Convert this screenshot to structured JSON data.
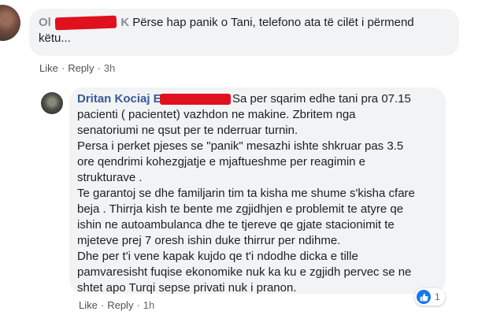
{
  "comment": {
    "author_prefix": "Ol",
    "author_suffix": "K",
    "text_line1": "Përse hap panik o Tani, telefono ata të cilët i përmend",
    "text_line2": "këtu...",
    "like_label": "Like",
    "reply_label": "Reply",
    "time": "3h"
  },
  "reply": {
    "author": "Dritan Kociaj E",
    "lines": [
      "Sa per sqarim edhe tani pra 07.15",
      "pacienti ( pacientet) vazhdon ne makine. Zbritem nga",
      "senatoriumi ne qsut per te nderruar turnin.",
      "Persa i perket pjeses se \"panik\" mesazhi ishte shkruar pas 3.5",
      "ore qendrimi kohezgjatje e mjaftueshme per reagimin e",
      "strukturave .",
      "Te garantoj se dhe familjarin tim ta kisha me shume s'kisha cfare",
      "beja . Thirrja kish te bente me zgjidhjen e problemit te atyre qe",
      "ishin ne autoambulanca dhe te tjereve qe gjate stacionimit te",
      "mjeteve prej 7 oresh ishin duke thirrur per ndihme.",
      "Dhe per t'i vene kapak kujdo qe t'i ndodhe dicka e tille",
      "pamvaresisht fuqise ekonomike nuk ka ku e zgjidh pervec se ne",
      "shtet apo Turqi sepse privati nuk i pranon."
    ],
    "like_label": "Like",
    "reply_label": "Reply",
    "time": "1h",
    "reaction_count": "1",
    "reaction_icon": "thumbs-up-icon"
  },
  "colors": {
    "name": "#385898",
    "bubble": "#f2f3f5",
    "redaction": "#e0101e",
    "like_blue": "#1877f2"
  }
}
